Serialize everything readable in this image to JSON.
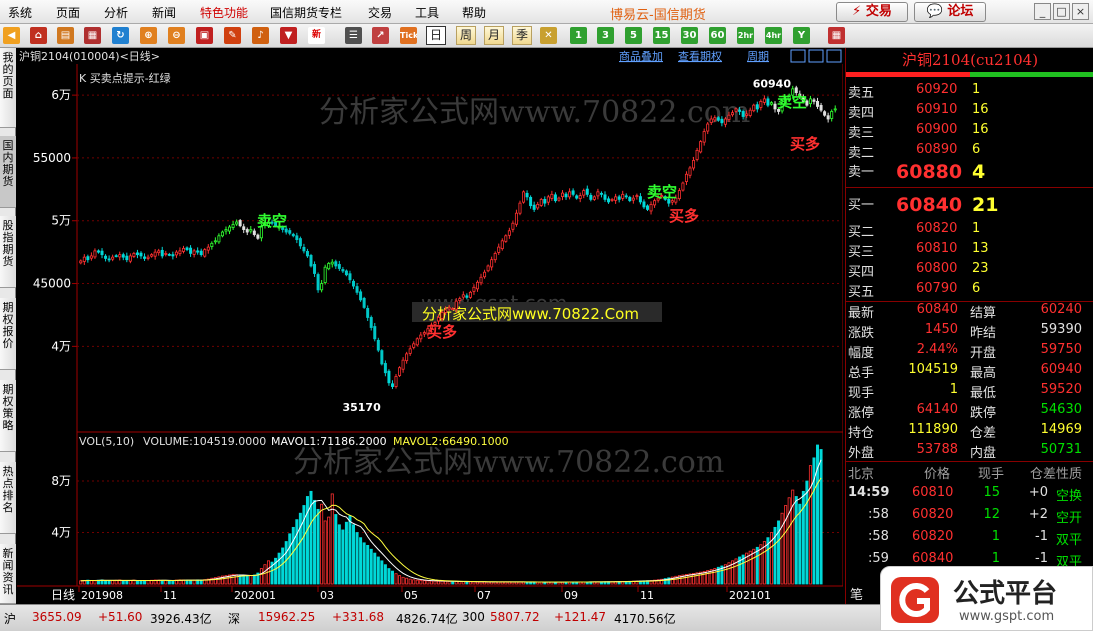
{
  "menu": [
    "系统",
    "页面",
    "分析",
    "新闻",
    "特色功能",
    "国信期货专栏",
    "交易",
    "工具",
    "帮助"
  ],
  "brand": "博易云-国信期货",
  "trade_button": "交易",
  "forum_button": "论坛",
  "toolbar_buttons": [
    "日",
    "周",
    "月",
    "季",
    "1",
    "3",
    "5",
    "15",
    "30",
    "60",
    "2hr",
    "4hr",
    "Y"
  ],
  "left_tabs": [
    "我的页面",
    "国内期货",
    "股指期货",
    "期权报价",
    "期权策略",
    "热点排名",
    "新闻资讯"
  ],
  "chart_header": {
    "symbol": "沪铜2104(010004)<日线>",
    "links": [
      "商品叠加",
      "查看期权",
      "周期"
    ],
    "indicator_title": "K 买卖点提示-红绿"
  },
  "watermarks": [
    "分析家公式网www.70822.com",
    "www.gspt.com",
    "分析家公式网www.70822.Com",
    "分析家公式网www.70822.com"
  ],
  "signals": [
    "卖空",
    "买多",
    "卖空",
    "买多",
    "卖空",
    "买多"
  ],
  "price_labels": {
    "high": "60940",
    "low": "35170"
  },
  "volume_header": {
    "prefix": "VOL(5,10)",
    "volume": "VOLUME:104519.0000",
    "mavol1": "MAVOL1:71186.2000",
    "mavol2": "MAVOL2:66490.1000"
  },
  "period_label": "日线",
  "chart_data": {
    "type": "candlestick",
    "price_axis_ticks": [
      "6万",
      "55000",
      "5万",
      "45000",
      "4万"
    ],
    "price_axis_values": [
      60000,
      55000,
      50000,
      45000,
      40000
    ],
    "volume_axis_ticks": [
      "8万",
      "4万"
    ],
    "volume_axis_values": [
      80000,
      40000
    ],
    "x_axis_ticks": [
      "201908",
      "11",
      "202001",
      "03",
      "05",
      "07",
      "09",
      "11",
      "202101"
    ],
    "price_range": [
      33500,
      62000
    ],
    "volume_range": [
      0,
      115000
    ],
    "high": 60940,
    "low": 35170,
    "volume_last": 104519,
    "mavol1_last": 71186.2,
    "mavol2_last": 66490.1,
    "series": [
      {
        "name": "K",
        "closes": [
          46800,
          47100,
          46900,
          47200,
          47600,
          47500,
          47300,
          47000,
          46900,
          47100,
          47200,
          47300,
          47100,
          46900,
          47200,
          47400,
          47300,
          47200,
          47000,
          47100,
          47300,
          47500,
          47600,
          47200,
          47400,
          47300,
          47200,
          47500,
          47600,
          47800,
          47700,
          47400,
          47600,
          47500,
          47300,
          47700,
          47900,
          48200,
          48400,
          48800,
          49100,
          49300,
          49500,
          49700,
          49900,
          49600,
          49300,
          49100,
          49300,
          48900,
          48600,
          49500,
          49700,
          49900,
          49800,
          49600,
          49500,
          49300,
          49100,
          49000,
          48800,
          48500,
          48000,
          47600,
          47200,
          46400,
          45800,
          44500,
          45000,
          46300,
          46600,
          46700,
          46400,
          46200,
          46000,
          45700,
          45300,
          44800,
          44300,
          43700,
          43100,
          42300,
          41500,
          40600,
          39700,
          38600,
          37900,
          37100,
          36800,
          37600,
          38300,
          38900,
          39400,
          39800,
          40200,
          40600,
          40900,
          41100,
          41400,
          41700,
          41900,
          42300,
          42700,
          42900,
          43100,
          43000,
          43600,
          43800,
          44100,
          43900,
          44300,
          44700,
          45100,
          45500,
          45900,
          46400,
          46900,
          47400,
          47900,
          48400,
          48800,
          49200,
          49800,
          50600,
          51400,
          52300,
          51900,
          51200,
          50900,
          51300,
          51700,
          51400,
          51900,
          52100,
          51600,
          51800,
          52200,
          51900,
          52300,
          52100,
          51800,
          52000,
          52400,
          52100,
          51700,
          51900,
          52300,
          52100,
          51700,
          51500,
          51700,
          51900,
          51700,
          52100,
          51900,
          51600,
          51800,
          52000,
          51500,
          51100,
          50900,
          51300,
          51600,
          51800,
          52000,
          51700,
          51400,
          51600,
          51800,
          52400,
          53000,
          53700,
          54200,
          54800,
          55600,
          56300,
          57100,
          57700,
          58100,
          58200,
          58000,
          57800,
          58100,
          58400,
          58600,
          58900,
          58700,
          58300,
          58500,
          58800,
          59200,
          58900,
          59500,
          59700,
          59200,
          59400,
          58900,
          58700,
          59300,
          59700,
          60000,
          60500,
          60200,
          59900,
          59500,
          59200,
          59700,
          59500,
          59100,
          58800,
          58400,
          58100,
          58700,
          58900
        ]
      },
      {
        "name": "VOL",
        "values": [
          2500,
          2800,
          3000,
          2700,
          2600,
          2900,
          3200,
          2800,
          2500,
          2700,
          2900,
          3100,
          2600,
          2400,
          2800,
          3000,
          2700,
          2600,
          2500,
          2700,
          2900,
          3100,
          3000,
          2700,
          2800,
          2600,
          2700,
          3000,
          3200,
          3100,
          2900,
          2800,
          3000,
          3200,
          3100,
          3400,
          3800,
          4500,
          5000,
          5600,
          6200,
          6500,
          7000,
          7500,
          7200,
          6800,
          6400,
          6200,
          6600,
          7000,
          8500,
          12000,
          15000,
          18000,
          17000,
          20000,
          24000,
          28000,
          33000,
          39000,
          44000,
          50000,
          55000,
          61000,
          68000,
          72000,
          65000,
          58000,
          62000,
          49000,
          52000,
          70000,
          54000,
          46000,
          42000,
          48000,
          53000,
          46000,
          40000,
          36000,
          32000,
          30000,
          27000,
          24000,
          21000,
          18000,
          15000,
          12000,
          10000,
          8000,
          6500,
          5200,
          4500,
          3800,
          3300,
          3000,
          2800,
          2600,
          2500,
          2400,
          2300,
          2200,
          2200,
          2100,
          2000,
          2000,
          1900,
          1900,
          1800,
          1800,
          1800,
          1700,
          1700,
          1700,
          1700,
          1600,
          1600,
          1600,
          1600,
          1700,
          1700,
          1700,
          1600,
          1600,
          1600,
          1600,
          1600,
          1500,
          1500,
          1500,
          1500,
          1500,
          1500,
          1500,
          1500,
          1500,
          1500,
          1600,
          1600,
          1600,
          1600,
          1600,
          1600,
          1600,
          1700,
          1700,
          1700,
          1700,
          1700,
          1800,
          1800,
          1900,
          1900,
          2000,
          2000,
          2100,
          2200,
          2300,
          2400,
          2500,
          2600,
          2700,
          3000,
          3300,
          3700,
          4200,
          4800,
          5400,
          6000,
          6600,
          7000,
          7400,
          7800,
          8200,
          8700,
          9200,
          9800,
          10500,
          11200,
          12000,
          13000,
          14000,
          15000,
          16500,
          18000,
          19500,
          21000,
          22500,
          24000,
          25500,
          27000,
          28500,
          30500,
          33000,
          36000,
          40000,
          44000,
          49000,
          55000,
          61000,
          67000,
          73000,
          68000,
          62000,
          72000,
          80000,
          92000,
          98000,
          108000,
          104519
        ]
      }
    ]
  },
  "right_panel": {
    "title": "沪铜2104(cu2104)",
    "asks": [
      {
        "label": "卖五",
        "price": "60920",
        "qty": "1"
      },
      {
        "label": "卖四",
        "price": "60910",
        "qty": "16"
      },
      {
        "label": "卖三",
        "price": "60900",
        "qty": "16"
      },
      {
        "label": "卖二",
        "price": "60890",
        "qty": "6"
      },
      {
        "label": "卖一",
        "price": "60880",
        "qty": "4"
      }
    ],
    "bids": [
      {
        "label": "买一",
        "price": "60840",
        "qty": "21"
      },
      {
        "label": "买二",
        "price": "60820",
        "qty": "1"
      },
      {
        "label": "买三",
        "price": "60810",
        "qty": "13"
      },
      {
        "label": "买四",
        "price": "60800",
        "qty": "23"
      },
      {
        "label": "买五",
        "price": "60790",
        "qty": "6"
      }
    ],
    "stats": [
      {
        "l1": "最新",
        "v1": "60840",
        "l2": "结算",
        "v2": "60240",
        "c1": "red",
        "c2": "red"
      },
      {
        "l1": "涨跌",
        "v1": "1450",
        "l2": "昨结",
        "v2": "59390",
        "c1": "red",
        "c2": "wht"
      },
      {
        "l1": "幅度",
        "v1": "2.44%",
        "l2": "开盘",
        "v2": "59750",
        "c1": "red",
        "c2": "red"
      },
      {
        "l1": "总手",
        "v1": "104519",
        "l2": "最高",
        "v2": "60940",
        "c1": "yel",
        "c2": "red"
      },
      {
        "l1": "现手",
        "v1": "1",
        "l2": "最低",
        "v2": "59520",
        "c1": "yel",
        "c2": "red"
      },
      {
        "l1": "涨停",
        "v1": "64140",
        "l2": "跌停",
        "v2": "54630",
        "c1": "red",
        "c2": "grn"
      },
      {
        "l1": "持仓",
        "v1": "111890",
        "l2": "仓差",
        "v2": "14969",
        "c1": "yel",
        "c2": "yel"
      },
      {
        "l1": "外盘",
        "v1": "53788",
        "l2": "内盘",
        "v2": "50731",
        "c1": "red",
        "c2": "grn"
      }
    ],
    "tick_header": [
      "北京",
      "价格",
      "现手",
      "仓差",
      "性质"
    ],
    "ticks": [
      {
        "time": "14:59",
        "price": "60810",
        "qty": "15",
        "diff": "+0",
        "nature": "空换",
        "nc": "grn"
      },
      {
        "time": ":58",
        "price": "60820",
        "qty": "12",
        "diff": "+2",
        "nature": "空开",
        "nc": "grn"
      },
      {
        "time": ":58",
        "price": "60820",
        "qty": "1",
        "diff": "-1",
        "nature": "双平",
        "nc": "grn"
      },
      {
        "time": ":59",
        "price": "60840",
        "qty": "1",
        "diff": "-1",
        "nature": "双平",
        "nc": "grn"
      }
    ],
    "bottom_tab": "笔"
  },
  "status_bar": [
    {
      "t": "沪",
      "c": "#000"
    },
    {
      "t": "3655.09",
      "c": "#c00000"
    },
    {
      "t": "+51.60",
      "c": "#c00000"
    },
    {
      "t": "3926.43亿",
      "c": "#000"
    },
    {
      "t": "深",
      "c": "#000"
    },
    {
      "t": "15962.25",
      "c": "#c00000"
    },
    {
      "t": "+331.68",
      "c": "#c00000"
    },
    {
      "t": "4826.74亿",
      "c": "#000"
    },
    {
      "t": "300",
      "c": "#000"
    },
    {
      "t": "5807.72",
      "c": "#c00000"
    },
    {
      "t": "+121.47",
      "c": "#c00000"
    },
    {
      "t": "4170.56亿",
      "c": "#000"
    }
  ],
  "logo": {
    "name": "公式平台",
    "url": "www.gspt.com"
  }
}
